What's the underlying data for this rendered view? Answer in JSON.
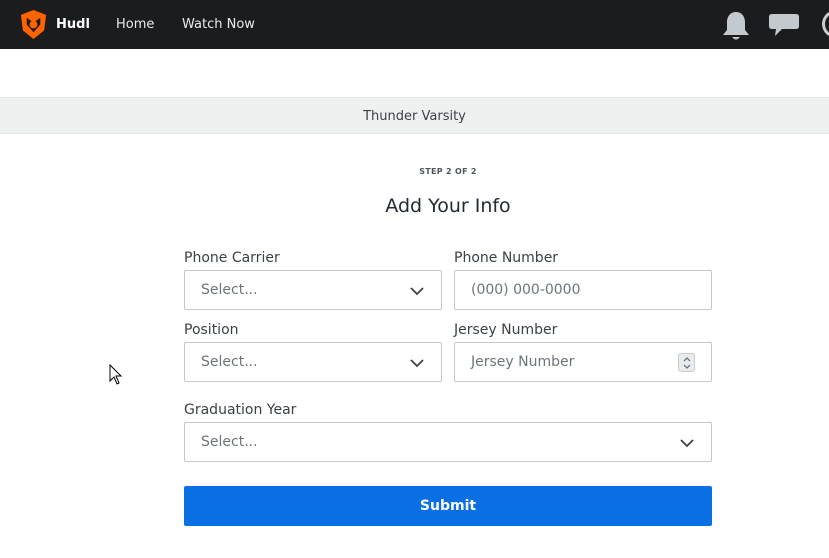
{
  "topbar": {
    "brand": "Hudl",
    "nav": [
      "Home",
      "Watch Now"
    ],
    "icons": [
      "hudl-logo-icon",
      "bell-icon",
      "chat-icon"
    ]
  },
  "team": {
    "name": "Thunder Varsity"
  },
  "form": {
    "step": "STEP 2 OF 2",
    "title": "Add Your Info",
    "phone_carrier": {
      "label": "Phone Carrier",
      "placeholder": "Select..."
    },
    "phone_number": {
      "label": "Phone Number",
      "placeholder": "(000) 000-0000"
    },
    "position": {
      "label": "Position",
      "placeholder": "Select..."
    },
    "jersey_number": {
      "label": "Jersey Number",
      "placeholder": "Jersey Number"
    },
    "graduation_year": {
      "label": "Graduation Year",
      "placeholder": "Select..."
    },
    "submit_label": "Submit"
  },
  "colors": {
    "topbar": "#1b1c1e",
    "brand_accent": "#ff6300",
    "primary_button": "#0a6fe3"
  }
}
